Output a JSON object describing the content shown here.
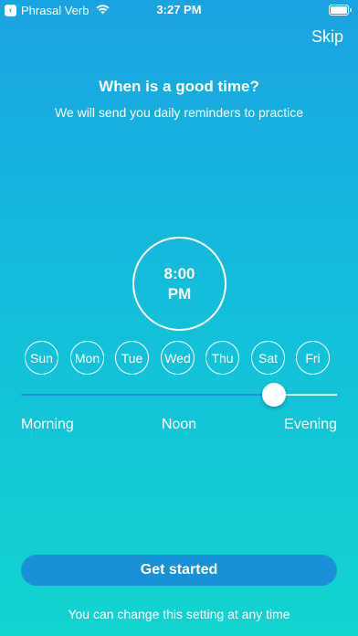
{
  "status": {
    "app_name": "Phrasal Verb",
    "time": "3:27 PM"
  },
  "header": {
    "skip_label": "Skip",
    "title": "When is a good time?",
    "subtitle": "We will send you daily reminders to practice"
  },
  "reminder": {
    "time_value": "8:00",
    "time_period": "PM"
  },
  "days": [
    "Sun",
    "Mon",
    "Tue",
    "Wed",
    "Thu",
    "Sat",
    "Fri"
  ],
  "slider": {
    "value_fraction": 0.8,
    "label_start": "Morning",
    "label_mid": "Noon",
    "label_end": "Evening"
  },
  "cta_label": "Get started",
  "footer_note": "You can change this setting at any time",
  "colors": {
    "accent": "#1a90d8",
    "gradient_top": "#1aa3e3",
    "gradient_bottom": "#12d4cf"
  }
}
